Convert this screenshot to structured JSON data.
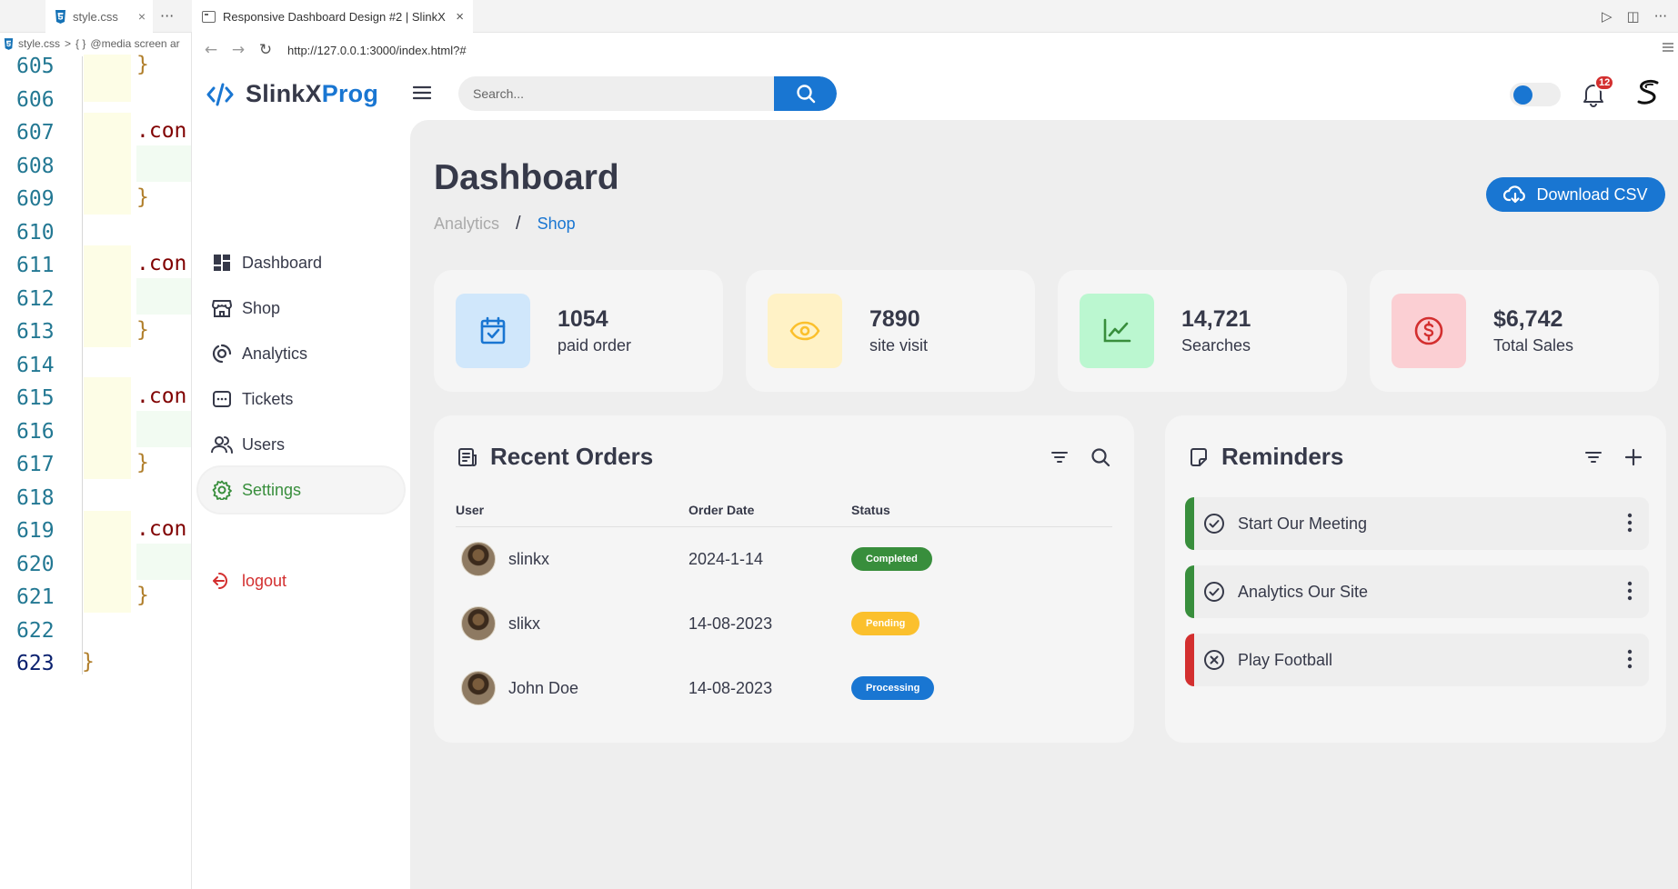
{
  "editor": {
    "tab_label": "style.css",
    "tab_close": "×",
    "more": "···",
    "breadcrumb": [
      "style.css",
      ">",
      "{ }",
      "@media screen ar"
    ],
    "lines": [
      {
        "n": "605",
        "code": "}",
        "kind": "brace"
      },
      {
        "n": "606",
        "code": "",
        "kind": "blank"
      },
      {
        "n": "607",
        "code": ".con",
        "kind": "sel"
      },
      {
        "n": "608",
        "code": "",
        "kind": "blank"
      },
      {
        "n": "609",
        "code": "}",
        "kind": "brace"
      },
      {
        "n": "610",
        "code": "",
        "kind": "blank"
      },
      {
        "n": "611",
        "code": ".con",
        "kind": "sel"
      },
      {
        "n": "612",
        "code": "",
        "kind": "blank"
      },
      {
        "n": "613",
        "code": "}",
        "kind": "brace"
      },
      {
        "n": "614",
        "code": "",
        "kind": "blank"
      },
      {
        "n": "615",
        "code": ".con",
        "kind": "sel"
      },
      {
        "n": "616",
        "code": "",
        "kind": "blank"
      },
      {
        "n": "617",
        "code": "}",
        "kind": "brace"
      },
      {
        "n": "618",
        "code": "",
        "kind": "blank"
      },
      {
        "n": "619",
        "code": ".con",
        "kind": "sel"
      },
      {
        "n": "620",
        "code": "",
        "kind": "blank"
      },
      {
        "n": "621",
        "code": "}",
        "kind": "brace"
      },
      {
        "n": "622",
        "code": "",
        "kind": "blank"
      },
      {
        "n": "623",
        "code": "}",
        "kind": "end"
      }
    ]
  },
  "browser": {
    "tab_title": "Responsive Dashboard Design #2 | SlinkX",
    "tab_close": "×",
    "url": "http://127.0.0.1:3000/index.html?#"
  },
  "app": {
    "brand_main": "SlinkX",
    "brand_accent": "Prog",
    "search_placeholder": "Search...",
    "notification_count": "12",
    "colors": {
      "primary": "#1976d2",
      "success": "#388e3c",
      "warning": "#fbc02d",
      "danger": "#d32f2f",
      "dark": "#363949"
    },
    "sidebar": {
      "items": [
        {
          "label": "Dashboard",
          "icon": "dashboard-icon"
        },
        {
          "label": "Shop",
          "icon": "store-icon"
        },
        {
          "label": "Analytics",
          "icon": "analytics-icon"
        },
        {
          "label": "Tickets",
          "icon": "ticket-icon"
        },
        {
          "label": "Users",
          "icon": "users-icon"
        },
        {
          "label": "Settings",
          "icon": "gear-icon",
          "active": true
        }
      ],
      "logout": "logout"
    },
    "header": {
      "title": "Dashboard",
      "breadcrumb": [
        "Analytics",
        "/",
        "Shop"
      ],
      "download_label": "Download CSV"
    },
    "insights": [
      {
        "value": "1054",
        "label": "paid order",
        "icon": "calendar-check-icon",
        "bg": "#d0e7fb",
        "fg": "#1976d2"
      },
      {
        "value": "7890",
        "label": "site visit",
        "icon": "eye-icon",
        "bg": "#fff2c6",
        "fg": "#fbc02d"
      },
      {
        "value": "14,721",
        "label": "Searches",
        "icon": "line-chart-icon",
        "bg": "#bbf7d0",
        "fg": "#388e3c"
      },
      {
        "value": "$6,742",
        "label": "Total Sales",
        "icon": "dollar-circle-icon",
        "bg": "#fbcfd3",
        "fg": "#d32f2f"
      }
    ],
    "orders": {
      "title": "Recent Orders",
      "columns": [
        "User",
        "Order Date",
        "Status"
      ],
      "rows": [
        {
          "user": "slinkx",
          "date": "2024-1-14",
          "status": "Completed",
          "status_color": "#388e3c"
        },
        {
          "user": "slikx",
          "date": "14-08-2023",
          "status": "Pending",
          "status_color": "#fbc02d"
        },
        {
          "user": "John Doe",
          "date": "14-08-2023",
          "status": "Processing",
          "status_color": "#1976d2"
        }
      ]
    },
    "reminders": {
      "title": "Reminders",
      "items": [
        {
          "label": "Start Our Meeting",
          "state": "completed",
          "bar": "#388e3c"
        },
        {
          "label": "Analytics Our Site",
          "state": "completed",
          "bar": "#388e3c"
        },
        {
          "label": "Play Football",
          "state": "not-completed",
          "bar": "#d32f2f"
        }
      ]
    }
  }
}
